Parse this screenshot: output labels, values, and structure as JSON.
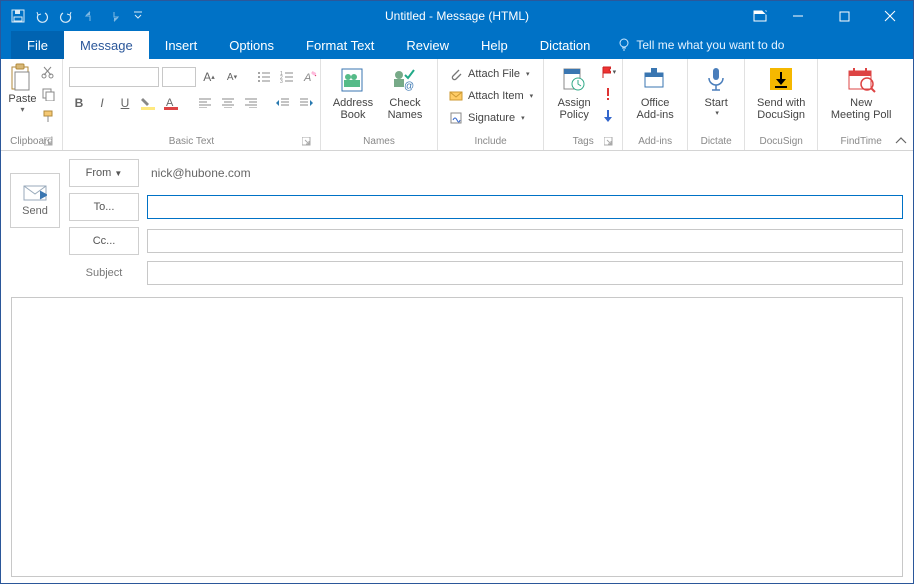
{
  "window": {
    "title": "Untitled  -  Message (HTML)"
  },
  "tabs": {
    "file": "File",
    "message": "Message",
    "insert": "Insert",
    "options": "Options",
    "format_text": "Format Text",
    "review": "Review",
    "help": "Help",
    "dictation": "Dictation",
    "tell_me": "Tell me what you want to do"
  },
  "ribbon": {
    "clipboard": {
      "label": "Clipboard",
      "paste": "Paste"
    },
    "basic_text": {
      "label": "Basic Text",
      "font_name": "",
      "font_size": ""
    },
    "names": {
      "label": "Names",
      "address_book": "Address\nBook",
      "check_names": "Check\nNames"
    },
    "include": {
      "label": "Include",
      "attach_file": "Attach File",
      "attach_item": "Attach Item",
      "signature": "Signature"
    },
    "tags": {
      "label": "Tags",
      "assign_policy": "Assign\nPolicy"
    },
    "addins": {
      "label": "Add-ins",
      "office_addins": "Office\nAdd-ins"
    },
    "dictate": {
      "label": "Dictate",
      "start": "Start"
    },
    "docusign": {
      "label": "DocuSign",
      "send_with": "Send with\nDocuSign"
    },
    "findtime": {
      "label": "FindTime",
      "new_poll": "New\nMeeting Poll"
    }
  },
  "compose": {
    "from_label": "From",
    "from_value": "nick@hubone.com",
    "to_label": "To...",
    "cc_label": "Cc...",
    "subject_label": "Subject",
    "send_label": "Send",
    "to_value": "",
    "cc_value": "",
    "subject_value": ""
  }
}
